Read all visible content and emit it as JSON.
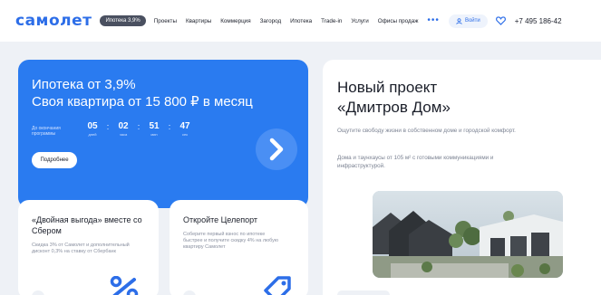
{
  "header": {
    "logo": "самолет",
    "promo_pill": "Ипотека 3,9%",
    "nav": [
      "Проекты",
      "Квартиры",
      "Коммерция",
      "Загород",
      "Ипотека",
      "Trade-in",
      "Услуги",
      "Офисы продаж"
    ],
    "more": "•••",
    "login": "Войти",
    "phone": "+7 495 186-42"
  },
  "promo": {
    "title": "Ипотека от 3,9%",
    "subtitle": "Своя квартира от 15 800 ₽ в месяц",
    "countdown_label": "До окончания программы",
    "countdown": [
      {
        "value": "05",
        "unit": "дней"
      },
      {
        "value": "02",
        "unit": "часа"
      },
      {
        "value": "51",
        "unit": "мин"
      },
      {
        "value": "47",
        "unit": "сек"
      }
    ],
    "button": "Подробнее"
  },
  "project": {
    "title_line1": "Новый проект",
    "title_line2": "«Дмитров Дом»",
    "desc1": "Ощутите свободу жизни в собственном доме и городской комфорт.",
    "desc2": "Дома и таунхаусы от 105 м² с готовыми коммуникациями и инфраструктурой."
  },
  "cards": [
    {
      "title": "«Двойная выгода» вместе со Сбером",
      "text": "Скидка 3% от Самолет и дополнительный дисконт 0,3% на ставку от Сбербанк",
      "icon": "percent-icon"
    },
    {
      "title": "Откройте Целепорт",
      "text": "Соберите первый взнос по ипотеке быстрее и получите скидку 4% на любую квартиру Самолет",
      "icon": "tag-icon"
    }
  ],
  "colors": {
    "accent": "#2d6ee8",
    "promo_bg": "#2a7bf0",
    "page_bg": "#eef1f6"
  }
}
